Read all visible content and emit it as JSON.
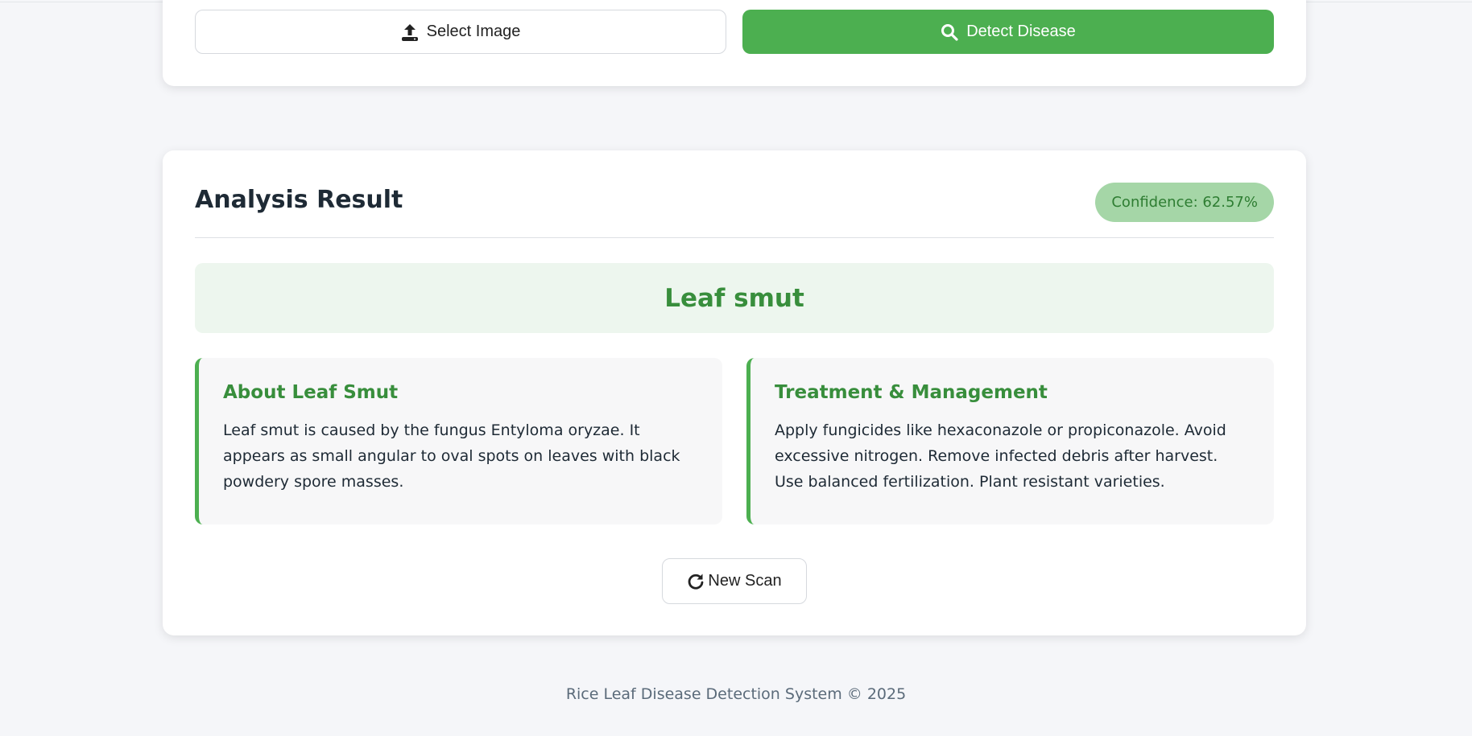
{
  "upload": {
    "select_label": "Select Image",
    "detect_label": "Detect Disease"
  },
  "result": {
    "title": "Analysis Result",
    "confidence": "Confidence: 62.57%",
    "disease": "Leaf smut",
    "about": {
      "heading": "About Leaf Smut",
      "text": "Leaf smut is caused by the fungus Entyloma oryzae. It appears as small angular to oval spots on leaves with black powdery spore masses."
    },
    "treatment": {
      "heading": "Treatment & Management",
      "text": "Apply fungicides like hexaconazole or propiconazole. Avoid excessive nitrogen. Remove infected debris after harvest. Use balanced fertilization. Plant resistant varieties."
    },
    "new_scan_label": "New Scan"
  },
  "footer": {
    "text": "Rice Leaf Disease Detection System © 2025"
  },
  "colors": {
    "accent": "#4caf50",
    "accent_dark": "#388e3c",
    "badge_bg": "#a5d6a7",
    "banner_bg": "#edf6ee",
    "page_bg": "#f5f6f9"
  },
  "icons": {
    "select": "upload-icon",
    "detect": "search-icon",
    "new_scan": "refresh-icon"
  }
}
